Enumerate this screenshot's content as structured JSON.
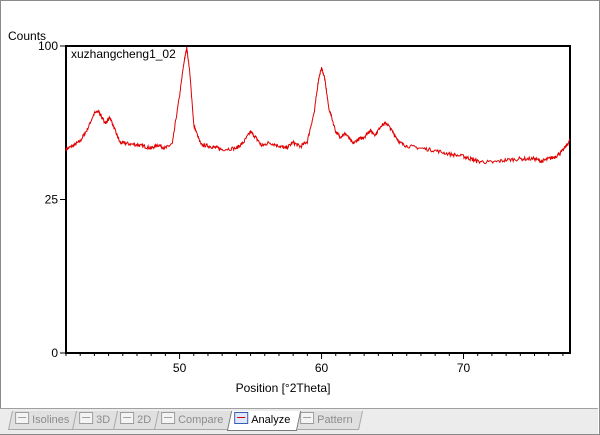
{
  "tabs": [
    {
      "label": "Isolines",
      "icon": "isolines-icon",
      "active": false
    },
    {
      "label": "3D",
      "icon": "3d-view-icon",
      "active": false
    },
    {
      "label": "2D",
      "icon": "2d-view-icon",
      "active": false
    },
    {
      "label": "Compare",
      "icon": "compare-icon",
      "active": false
    },
    {
      "label": "Analyze",
      "icon": "analyze-icon",
      "active": true
    },
    {
      "label": "Pattern",
      "icon": "pattern-icon",
      "active": false
    }
  ],
  "chart_data": {
    "type": "line",
    "title": "",
    "series_label": "xuzhangcheng1_02",
    "xlabel": "Position [°2Theta]",
    "ylabel": "Counts",
    "xlim": [
      42,
      77.5
    ],
    "ylim": [
      0,
      100
    ],
    "xticks": [
      "50",
      "60",
      "70"
    ],
    "xtick_values": [
      50,
      60,
      70
    ],
    "yticks": [
      "0",
      "25",
      "100"
    ],
    "ytick_values": [
      0,
      25,
      100
    ],
    "y_scale": "sqrt",
    "line_color": "#e00000",
    "grid": false,
    "x": [
      42.0,
      42.5,
      43.0,
      43.5,
      44.0,
      44.3,
      44.6,
      44.8,
      45.1,
      45.4,
      45.8,
      46.3,
      47.0,
      47.5,
      48.0,
      48.5,
      49.0,
      49.5,
      50.0,
      50.3,
      50.5,
      50.7,
      51.0,
      51.5,
      52.0,
      52.5,
      53.0,
      54.0,
      54.5,
      55.0,
      55.4,
      55.8,
      56.3,
      57.0,
      57.5,
      58.0,
      58.5,
      59.0,
      59.5,
      59.8,
      60.0,
      60.2,
      60.5,
      61.0,
      61.3,
      61.7,
      62.2,
      62.6,
      63.0,
      63.4,
      63.8,
      64.2,
      64.6,
      65.0,
      65.5,
      66.0,
      67.0,
      68.0,
      69.0,
      70.0,
      70.5,
      71.0,
      72.0,
      73.0,
      74.0,
      75.0,
      75.5,
      76.0,
      76.5,
      77.0,
      77.5
    ],
    "y": [
      44.0,
      45.6,
      47.6,
      53.0,
      61.0,
      62.0,
      58.0,
      56.0,
      59.0,
      53.5,
      47.0,
      46.5,
      46.0,
      45.3,
      44.5,
      46.0,
      44.5,
      46.5,
      70.0,
      89.0,
      99.0,
      85.0,
      55.0,
      46.0,
      45.5,
      44.8,
      44.0,
      44.5,
      47.0,
      52.0,
      49.0,
      45.5,
      47.0,
      45.5,
      44.5,
      47.0,
      45.2,
      47.5,
      62.0,
      80.0,
      86.0,
      81.0,
      64.0,
      52.0,
      49.6,
      51.0,
      46.5,
      48.5,
      49.5,
      52.5,
      50.5,
      55.0,
      56.0,
      52.0,
      47.0,
      45.5,
      44.5,
      43.5,
      42.0,
      41.0,
      40.0,
      39.0,
      38.5,
      39.5,
      40.0,
      40.0,
      39.0,
      40.0,
      41.0,
      43.5,
      48.0
    ]
  }
}
